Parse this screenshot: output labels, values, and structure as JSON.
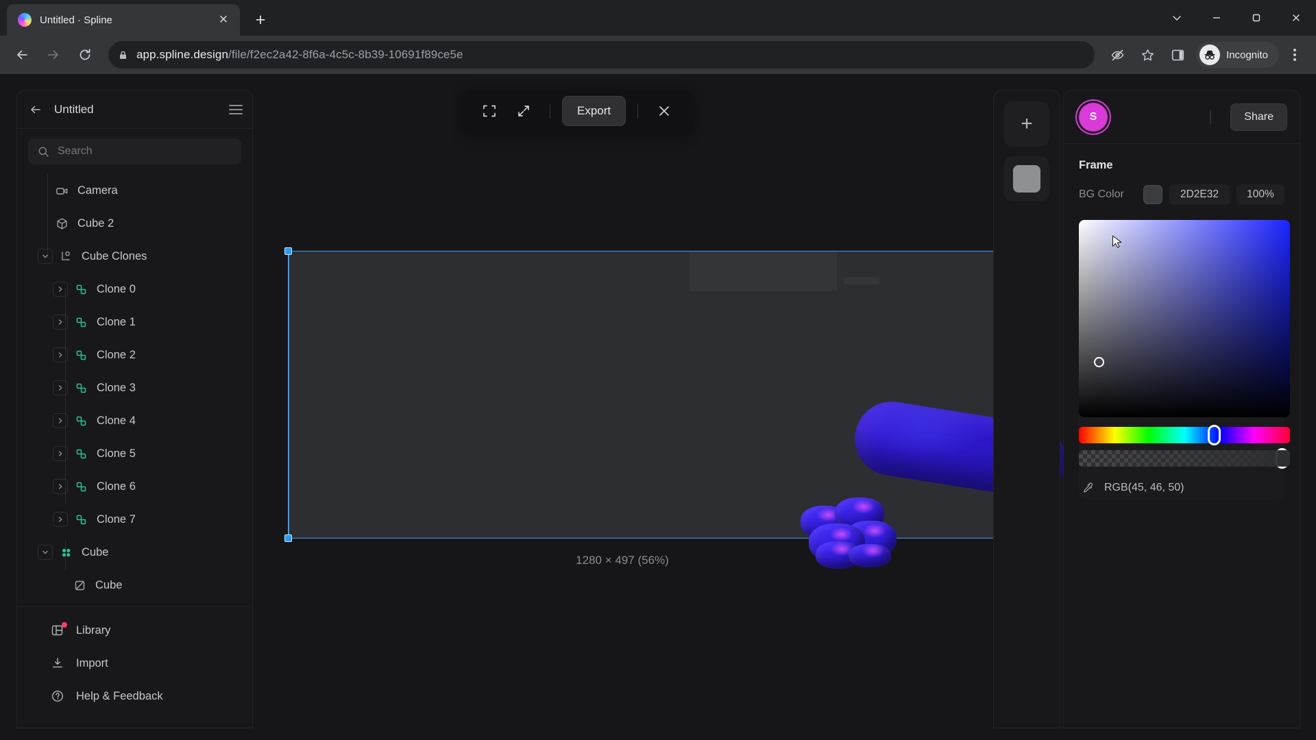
{
  "browser": {
    "tab": {
      "title": "Untitled · Spline",
      "favicon_icon": "spline-logo-icon",
      "close_icon": "close-icon"
    },
    "new_tab_label": "+",
    "window_controls": {
      "minimize_chevron": "chevron-down-icon",
      "minimize": "minimize-icon",
      "maximize": "maximize-icon",
      "close": "close-icon"
    },
    "nav": {
      "back_icon": "arrow-left-icon",
      "forward_icon": "arrow-right-icon",
      "reload_icon": "reload-icon"
    },
    "omnibox": {
      "lock_icon": "lock-icon",
      "url_domain": "app.spline.design",
      "url_path": "/file/f2ec2a42-8f6a-4c5c-8b39-10691f89ce5e"
    },
    "actions": {
      "tracking_icon": "eye-slash-icon",
      "bookmark_icon": "star-icon",
      "sidepanel_icon": "side-panel-icon",
      "profile_label": "Incognito",
      "profile_icon": "incognito-icon",
      "menu_icon": "three-dots-icon"
    }
  },
  "left_panel": {
    "back_icon": "arrow-left-icon",
    "title": "Untitled",
    "menu_icon": "hamburger-icon",
    "search": {
      "placeholder": "Search",
      "value": "",
      "icon": "search-icon"
    },
    "tree": [
      {
        "label": "Camera",
        "icon": "camera-icon",
        "depth": 1,
        "chevron": "none"
      },
      {
        "label": "Cube 2",
        "icon": "cube-icon",
        "depth": 1,
        "chevron": "none"
      },
      {
        "label": "Cube Clones",
        "icon": "clone-axis-icon",
        "depth": 0,
        "chevron": "down"
      },
      {
        "label": "Clone 0",
        "icon": "clone-icon",
        "depth": 1,
        "chevron": "right"
      },
      {
        "label": "Clone 1",
        "icon": "clone-icon",
        "depth": 1,
        "chevron": "right"
      },
      {
        "label": "Clone 2",
        "icon": "clone-icon",
        "depth": 1,
        "chevron": "right"
      },
      {
        "label": "Clone 3",
        "icon": "clone-icon",
        "depth": 1,
        "chevron": "right"
      },
      {
        "label": "Clone 4",
        "icon": "clone-icon",
        "depth": 1,
        "chevron": "right"
      },
      {
        "label": "Clone 5",
        "icon": "clone-icon",
        "depth": 1,
        "chevron": "right"
      },
      {
        "label": "Clone 6",
        "icon": "clone-icon",
        "depth": 1,
        "chevron": "right"
      },
      {
        "label": "Clone 7",
        "icon": "clone-icon",
        "depth": 1,
        "chevron": "right"
      },
      {
        "label": "Cube",
        "icon": "four-dots-icon",
        "depth": 0,
        "chevron": "down"
      },
      {
        "label": "Cube",
        "icon": "shape-icon",
        "depth": 2,
        "chevron": "none"
      }
    ],
    "footer": [
      {
        "label": "Library",
        "icon": "library-icon",
        "badge": true
      },
      {
        "label": "Import",
        "icon": "import-icon",
        "badge": false
      },
      {
        "label": "Help & Feedback",
        "icon": "help-icon",
        "badge": false
      }
    ]
  },
  "canvas": {
    "toolbar": {
      "frame_icon": "crop-frame-icon",
      "expand_icon": "expand-diagonal-icon",
      "export_label": "Export",
      "close_icon": "close-icon"
    },
    "dimension_label": "1280 × 497 (56%)",
    "frame_bg_color": "#2D2E32",
    "selection_color": "#3B9BF0"
  },
  "right_rail": {
    "add_icon": "plus-icon",
    "add_label": "+",
    "swatch_icon": "color-swatch-icon",
    "swatch_color": "#8F9094"
  },
  "right_panel": {
    "avatar_initial": "S",
    "avatar_color": "#D93AD9",
    "share_label": "Share",
    "section_title": "Frame",
    "bg_color_label": "BG Color",
    "bg_hex": "2D2E32",
    "bg_alpha": "100%",
    "picker": {
      "rgb_label": "RGB(45, 46, 50)",
      "eyedropper_icon": "eyedropper-icon",
      "hue_degrees": 240,
      "cursor_icon": "mouse-cursor-icon"
    }
  }
}
